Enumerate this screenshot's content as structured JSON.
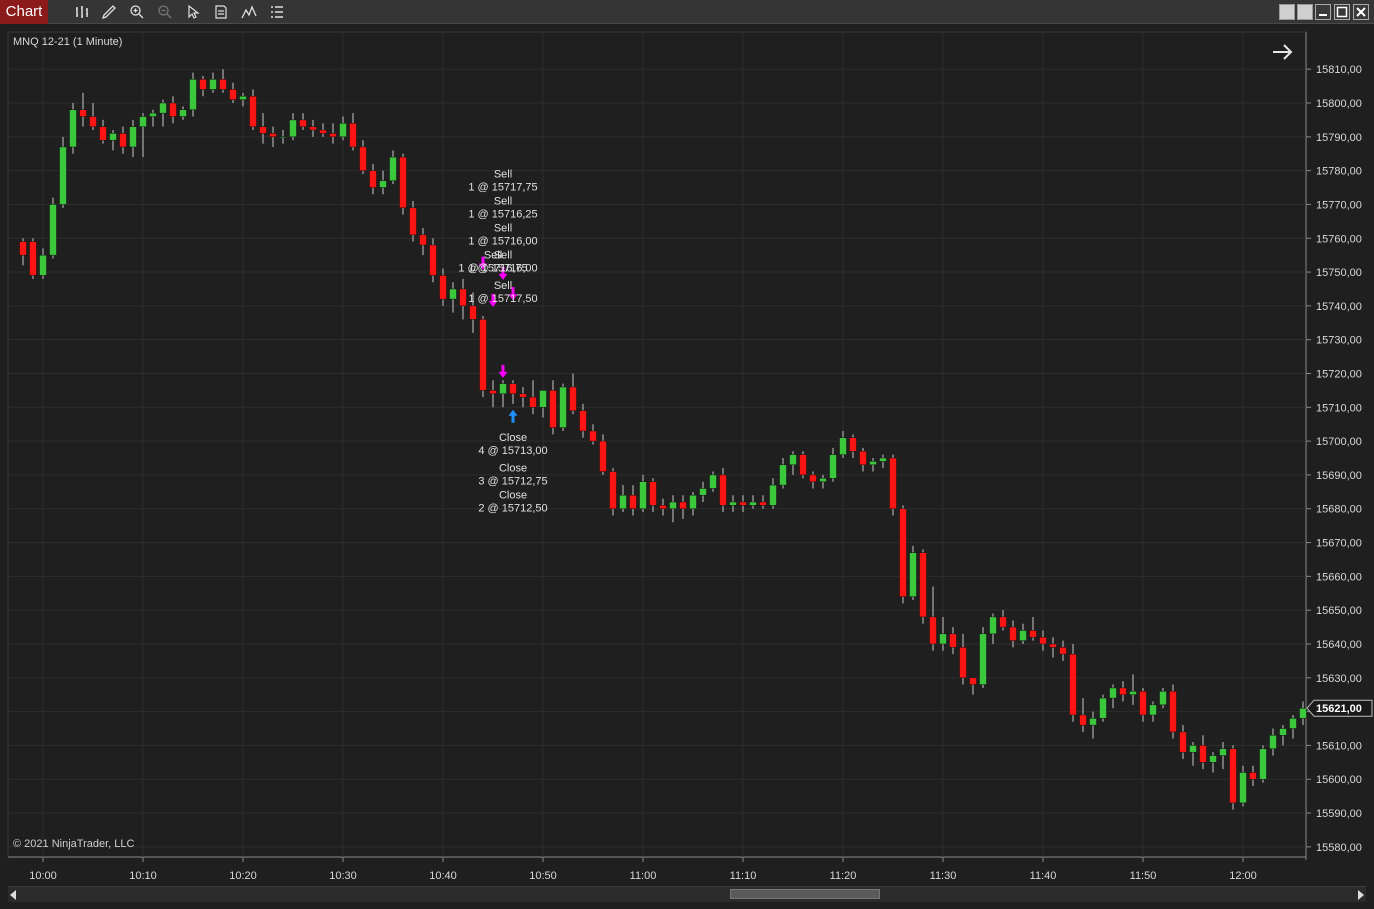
{
  "app": {
    "tab_label": "Chart",
    "instrument": "MNQ 12-21 (1 Minute)",
    "copyright": "© 2021 NinjaTrader, LLC",
    "toolbar_icons": [
      "bar-type-icon",
      "drawing-tool-icon",
      "zoom-in-icon",
      "zoom-out-icon",
      "pointer-icon",
      "properties-icon",
      "indicator-icon",
      "strategy-list-icon"
    ],
    "colors": {
      "up": "#3cc83c",
      "down": "#ff1414",
      "background": "#1f1f1f",
      "grid": "#2e2e2e",
      "sell_marker": "#ff00ff",
      "buy_marker": "#1e90ff",
      "title_tab": "#8b1a1a"
    }
  },
  "chart_data": {
    "type": "candlestick",
    "x_ticks": [
      "10:00",
      "10:10",
      "10:20",
      "10:30",
      "10:40",
      "10:50",
      "11:00",
      "11:10",
      "11:20",
      "11:30",
      "11:40",
      "11:50",
      "12:00"
    ],
    "y_ticks": [
      "15810,00",
      "15800,00",
      "15790,00",
      "15780,00",
      "15770,00",
      "15760,00",
      "15750,00",
      "15740,00",
      "15730,00",
      "15720,00",
      "15710,00",
      "15700,00",
      "15690,00",
      "15680,00",
      "15670,00",
      "15660,00",
      "15650,00",
      "15640,00",
      "15630,00",
      "15620,00",
      "15610,00",
      "15600,00",
      "15590,00",
      "15580,00"
    ],
    "ylim": [
      15577,
      15821
    ],
    "current_price": "15621,00",
    "current_price_value": 15621,
    "start_minute": 598,
    "candles": [
      [
        15759,
        15760,
        15752,
        15755
      ],
      [
        15759,
        15760,
        15748,
        15749
      ],
      [
        15749,
        15757,
        15748,
        15755
      ],
      [
        15755,
        15772,
        15754,
        15770
      ],
      [
        15770,
        15790,
        15769,
        15787
      ],
      [
        15787,
        15800,
        15785,
        15798
      ],
      [
        15798,
        15803,
        15793,
        15796
      ],
      [
        15796,
        15800,
        15792,
        15793
      ],
      [
        15793,
        15795,
        15788,
        15789
      ],
      [
        15789,
        15792,
        15786,
        15791
      ],
      [
        15791,
        15793,
        15785,
        15787
      ],
      [
        15787,
        15795,
        15784,
        15793
      ],
      [
        15793,
        15797,
        15784,
        15796
      ],
      [
        15796,
        15798,
        15793,
        15797
      ],
      [
        15797,
        15801,
        15793,
        15800
      ],
      [
        15800,
        15802,
        15794,
        15796
      ],
      [
        15796,
        15799,
        15795,
        15798
      ],
      [
        15798,
        15809,
        15796,
        15807
      ],
      [
        15807,
        15808,
        15802,
        15804
      ],
      [
        15804,
        15809,
        15803,
        15807
      ],
      [
        15807,
        15810,
        15803,
        15804
      ],
      [
        15804,
        15806,
        15800,
        15801
      ],
      [
        15801,
        15803,
        15799,
        15802
      ],
      [
        15802,
        15804,
        15792,
        15793
      ],
      [
        15793,
        15797,
        15788,
        15791
      ],
      [
        15791,
        15793,
        15787,
        15790
      ],
      [
        15790,
        15792,
        15788,
        15790
      ],
      [
        15790,
        15797,
        15789,
        15795
      ],
      [
        15795,
        15797,
        15792,
        15793
      ],
      [
        15793,
        15795,
        15790,
        15792
      ],
      [
        15792,
        15794,
        15790,
        15791
      ],
      [
        15791,
        15794,
        15788,
        15790
      ],
      [
        15790,
        15796,
        15789,
        15794
      ],
      [
        15794,
        15797,
        15786,
        15787
      ],
      [
        15787,
        15789,
        15779,
        15780
      ],
      [
        15780,
        15782,
        15773,
        15775
      ],
      [
        15775,
        15780,
        15773,
        15777
      ],
      [
        15777,
        15786,
        15776,
        15784
      ],
      [
        15784,
        15785,
        15767,
        15769
      ],
      [
        15769,
        15771,
        15759,
        15761
      ],
      [
        15761,
        15763,
        15755,
        15758
      ],
      [
        15758,
        15760,
        15747,
        15749
      ],
      [
        15749,
        15751,
        15740,
        15742
      ],
      [
        15742,
        15747,
        15738,
        15745
      ],
      [
        15745,
        15748,
        15736,
        15740
      ],
      [
        15740,
        15744,
        15732,
        15736
      ],
      [
        15736,
        15737,
        15713,
        15715
      ],
      [
        15715,
        15718,
        15710,
        15714
      ],
      [
        15714,
        15718,
        15710,
        15717
      ],
      [
        15717,
        15718,
        15711,
        15714
      ],
      [
        15714,
        15716,
        15710,
        15713
      ],
      [
        15713,
        15718,
        15708,
        15710
      ],
      [
        15710,
        15715,
        15707,
        15715
      ],
      [
        15715,
        15718,
        15702,
        15704
      ],
      [
        15704,
        15717,
        15703,
        15716
      ],
      [
        15716,
        15720,
        15708,
        15709
      ],
      [
        15709,
        15711,
        15701,
        15703
      ],
      [
        15703,
        15705,
        15699,
        15700
      ],
      [
        15700,
        15702,
        15690,
        15691
      ],
      [
        15691,
        15692,
        15678,
        15680
      ],
      [
        15680,
        15687,
        15679,
        15684
      ],
      [
        15684,
        15687,
        15678,
        15680
      ],
      [
        15680,
        15690,
        15679,
        15688
      ],
      [
        15688,
        15689,
        15679,
        15681
      ],
      [
        15681,
        15683,
        15678,
        15680
      ],
      [
        15680,
        15684,
        15676,
        15682
      ],
      [
        15682,
        15684,
        15677,
        15680
      ],
      [
        15680,
        15685,
        15678,
        15684
      ],
      [
        15684,
        15688,
        15682,
        15686
      ],
      [
        15686,
        15691,
        15685,
        15690
      ],
      [
        15690,
        15692,
        15679,
        15681
      ],
      [
        15681,
        15684,
        15679,
        15682
      ],
      [
        15682,
        15684,
        15679,
        15681
      ],
      [
        15681,
        15684,
        15680,
        15682
      ],
      [
        15682,
        15684,
        15680,
        15681
      ],
      [
        15681,
        15689,
        15680,
        15687
      ],
      [
        15687,
        15695,
        15686,
        15693
      ],
      [
        15693,
        15697,
        15690,
        15696
      ],
      [
        15696,
        15697,
        15689,
        15690
      ],
      [
        15690,
        15691,
        15686,
        15688
      ],
      [
        15688,
        15690,
        15686,
        15689
      ],
      [
        15689,
        15698,
        15688,
        15696
      ],
      [
        15696,
        15703,
        15695,
        15701
      ],
      [
        15701,
        15702,
        15695,
        15697
      ],
      [
        15697,
        15698,
        15691,
        15693
      ],
      [
        15693,
        15695,
        15691,
        15694
      ],
      [
        15694,
        15696,
        15692,
        15695
      ],
      [
        15695,
        15696,
        15678,
        15680
      ],
      [
        15680,
        15681,
        15652,
        15654
      ],
      [
        15654,
        15669,
        15653,
        15667
      ],
      [
        15667,
        15668,
        15646,
        15648
      ],
      [
        15648,
        15657,
        15638,
        15640
      ],
      [
        15640,
        15648,
        15638,
        15643
      ],
      [
        15643,
        15645,
        15637,
        15639
      ],
      [
        15639,
        15643,
        15628,
        15630
      ],
      [
        15630,
        15630,
        15625,
        15628
      ],
      [
        15628,
        15645,
        15627,
        15643
      ],
      [
        15643,
        15649,
        15640,
        15648
      ],
      [
        15648,
        15650,
        15644,
        15645
      ],
      [
        15645,
        15647,
        15639,
        15641
      ],
      [
        15641,
        15646,
        15640,
        15644
      ],
      [
        15644,
        15648,
        15641,
        15642
      ],
      [
        15642,
        15644,
        15638,
        15640
      ],
      [
        15640,
        15642,
        15636,
        15639
      ],
      [
        15639,
        15641,
        15635,
        15637
      ],
      [
        15637,
        15640,
        15617,
        15619
      ],
      [
        15619,
        15624,
        15614,
        15616
      ],
      [
        15616,
        15620,
        15612,
        15618
      ],
      [
        15618,
        15625,
        15617,
        15624
      ],
      [
        15624,
        15628,
        15621,
        15627
      ],
      [
        15627,
        15629,
        15623,
        15625
      ],
      [
        15625,
        15631,
        15622,
        15626
      ],
      [
        15626,
        15627,
        15617,
        15619
      ],
      [
        15619,
        15623,
        15617,
        15622
      ],
      [
        15622,
        15627,
        15621,
        15626
      ],
      [
        15626,
        15628,
        15612,
        15614
      ],
      [
        15614,
        15616,
        15606,
        15608
      ],
      [
        15608,
        15611,
        15604,
        15610
      ],
      [
        15610,
        15613,
        15603,
        15605
      ],
      [
        15605,
        15608,
        15602,
        15607
      ],
      [
        15607,
        15611,
        15603,
        15609
      ],
      [
        15609,
        15610,
        15591,
        15593
      ],
      [
        15593,
        15604,
        15592,
        15602
      ],
      [
        15602,
        15604,
        15598,
        15600
      ],
      [
        15600,
        15610,
        15599,
        15609
      ],
      [
        15609,
        15615,
        15607,
        15613
      ],
      [
        15613,
        15616,
        15610,
        15615
      ],
      [
        15615,
        15619,
        15612,
        15618
      ],
      [
        15618,
        15623,
        15616,
        15621
      ]
    ],
    "sell_markers": [
      {
        "minute": 644,
        "price": 15751
      },
      {
        "minute": 645,
        "price": 15740
      },
      {
        "minute": 646,
        "price": 15748
      },
      {
        "minute": 646,
        "price": 15719
      },
      {
        "minute": 647,
        "price": 15742
      }
    ],
    "buy_markers": [
      {
        "minute": 647,
        "price": 15709
      }
    ],
    "trade_labels": [
      {
        "title": "Sell",
        "detail": "1 @ 15717,75",
        "minute": 646,
        "price": 15778
      },
      {
        "title": "Sell",
        "detail": "1 @ 15716,25",
        "minute": 646,
        "price": 15770
      },
      {
        "title": "Sell",
        "detail": "1 @ 15716,00",
        "minute": 646,
        "price": 15762
      },
      {
        "title": "Sell",
        "detail": "1 @ 15716,75",
        "minute": 645,
        "price": 15754
      },
      {
        "title": "Sell",
        "detail": "1 @ 15716,00",
        "minute": 646,
        "price": 15754
      },
      {
        "title": "Sell",
        "detail": "1 @ 15717,50",
        "minute": 646,
        "price": 15745
      },
      {
        "title": "Close",
        "detail": "4 @ 15713,00",
        "minute": 647,
        "price": 15700
      },
      {
        "title": "Close",
        "detail": "3 @ 15712,75",
        "minute": 647,
        "price": 15691
      },
      {
        "title": "Close",
        "detail": "2 @ 15712,50",
        "minute": 647,
        "price": 15683
      }
    ]
  }
}
